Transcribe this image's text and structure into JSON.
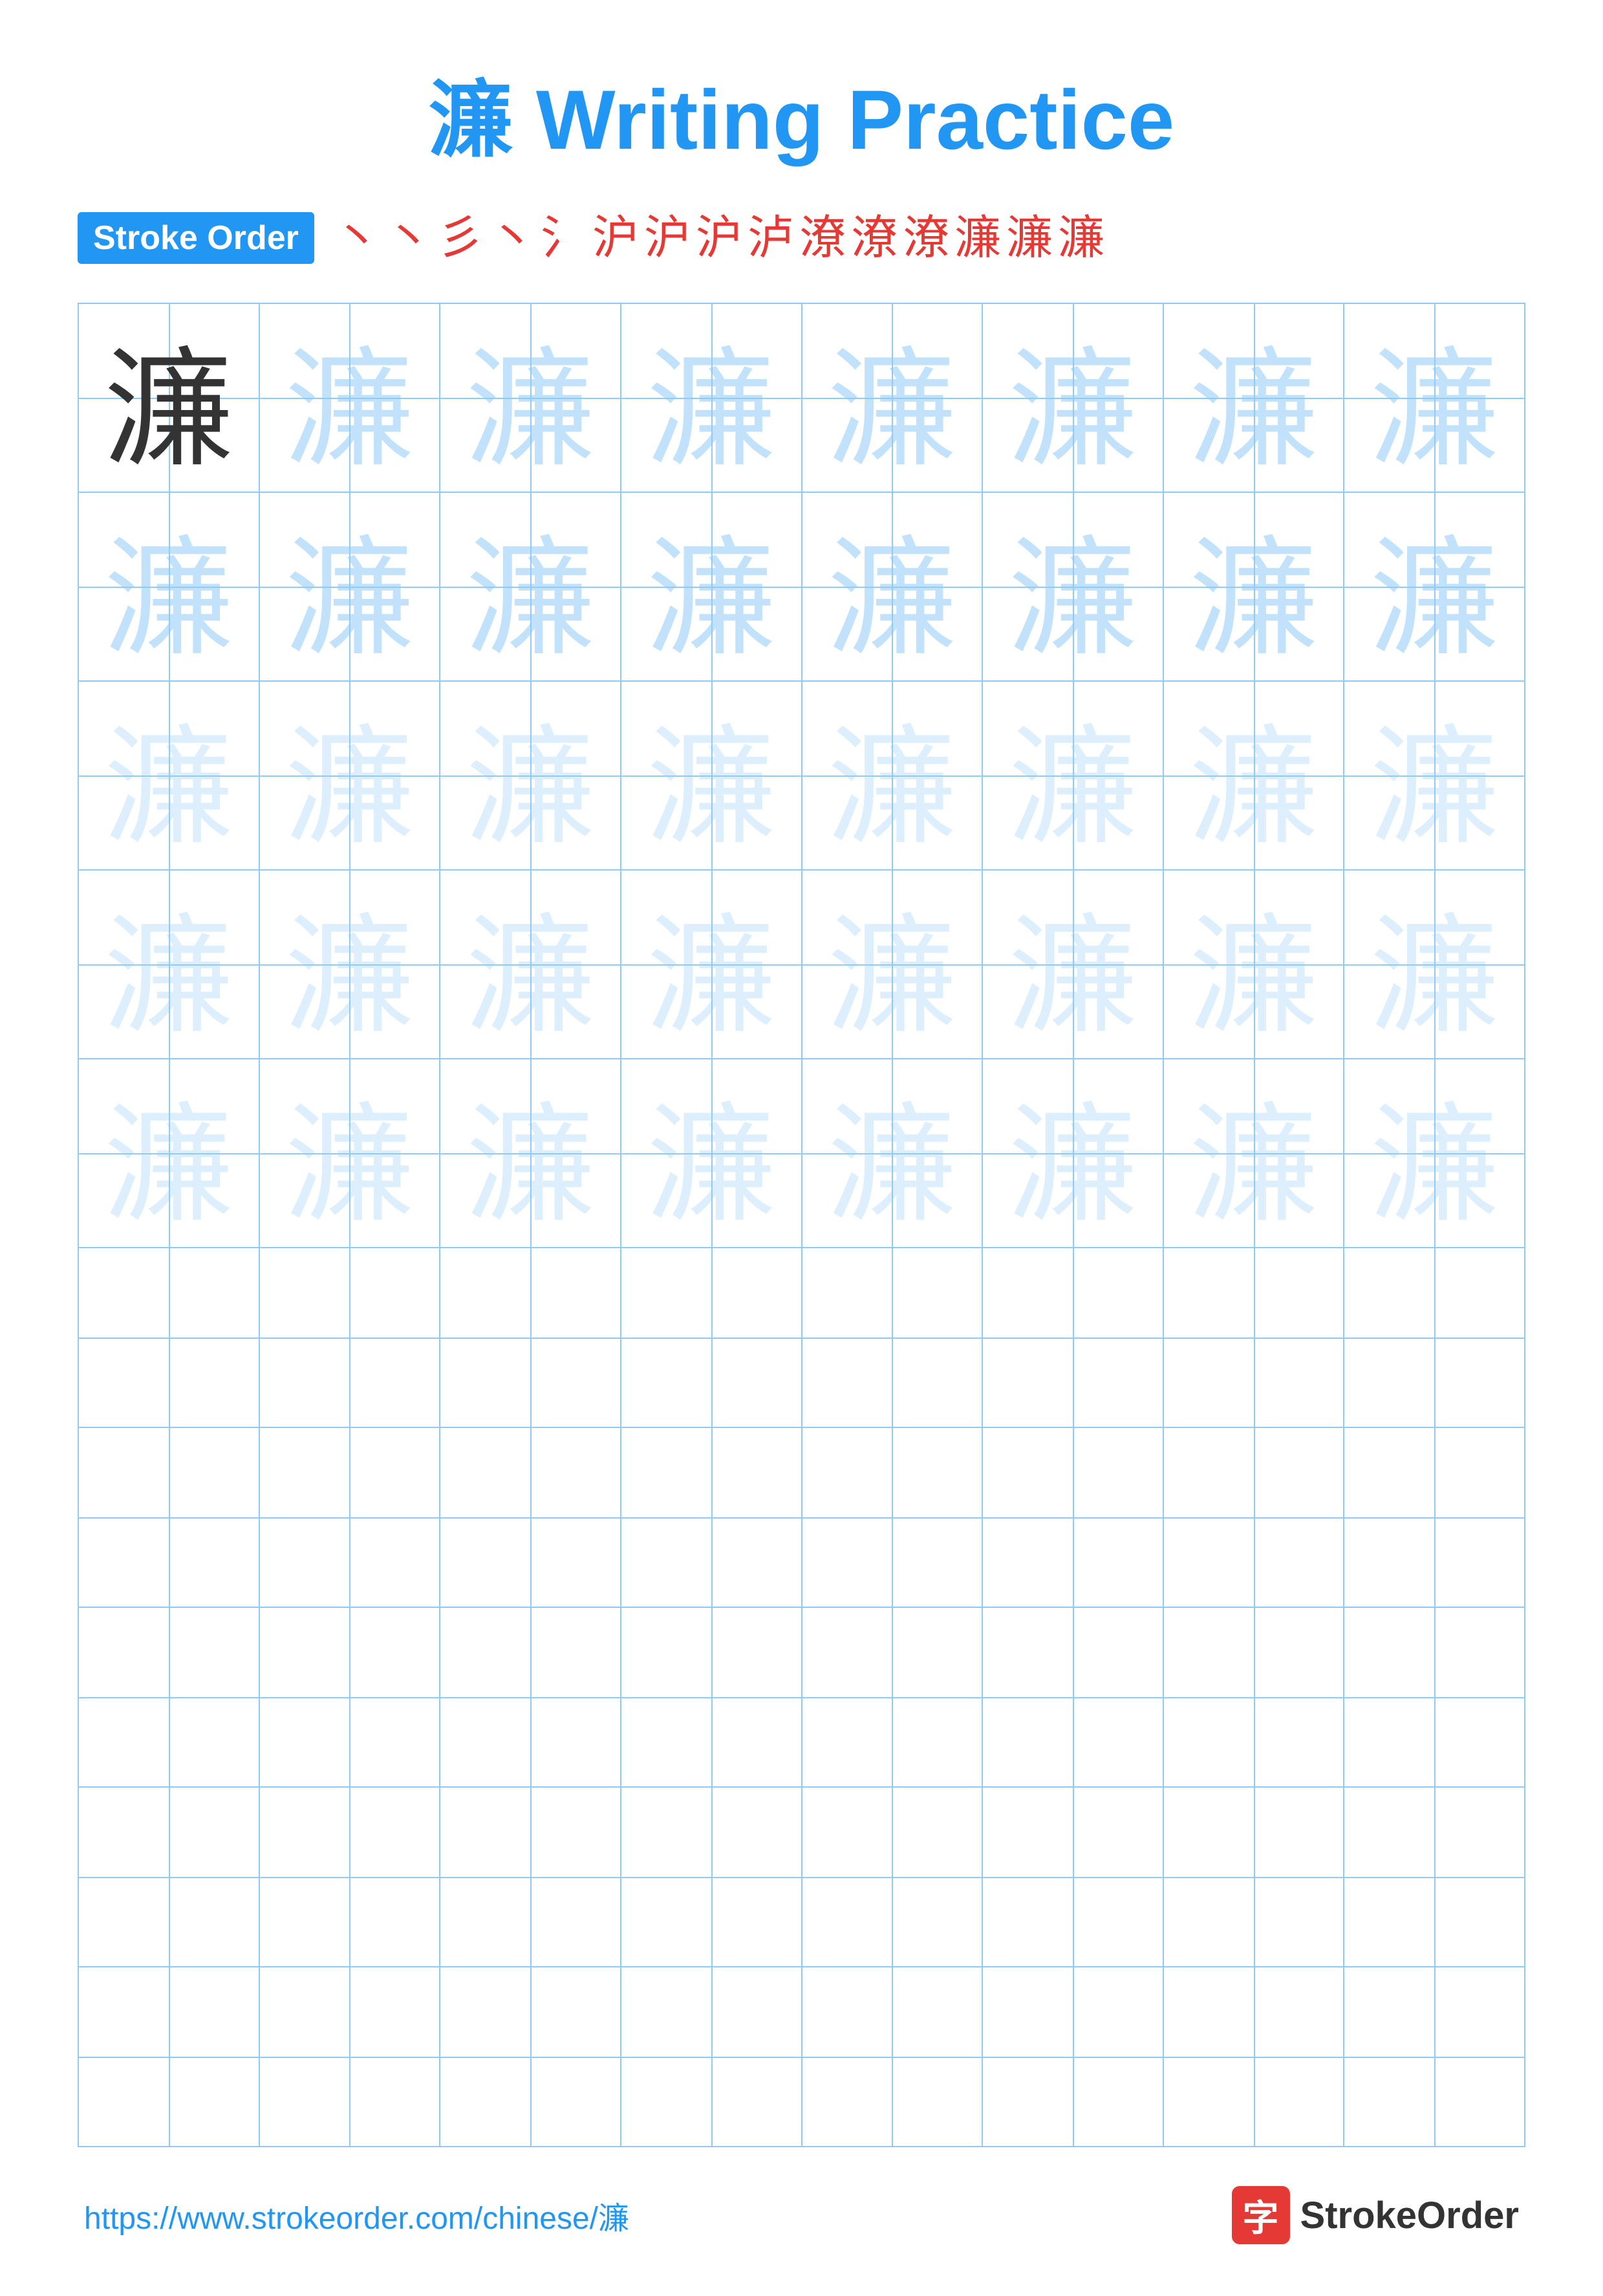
{
  "title": {
    "char": "濂",
    "suffix": " Writing Practice"
  },
  "stroke_order": {
    "badge_label": "Stroke Order",
    "strokes": [
      "丶",
      "丶",
      "彡",
      "丶",
      "氵",
      "沪",
      "沪",
      "沪",
      "泸",
      "潦",
      "潦",
      "潦",
      "濂",
      "濂",
      "濂"
    ]
  },
  "grid": {
    "rows": 10,
    "cols": 8,
    "character": "濂",
    "filled_rows": 5,
    "empty_rows": 5
  },
  "footer": {
    "url": "https://www.strokeorder.com/chinese/濂",
    "logo_char": "字",
    "logo_text": "StrokeOrder"
  }
}
